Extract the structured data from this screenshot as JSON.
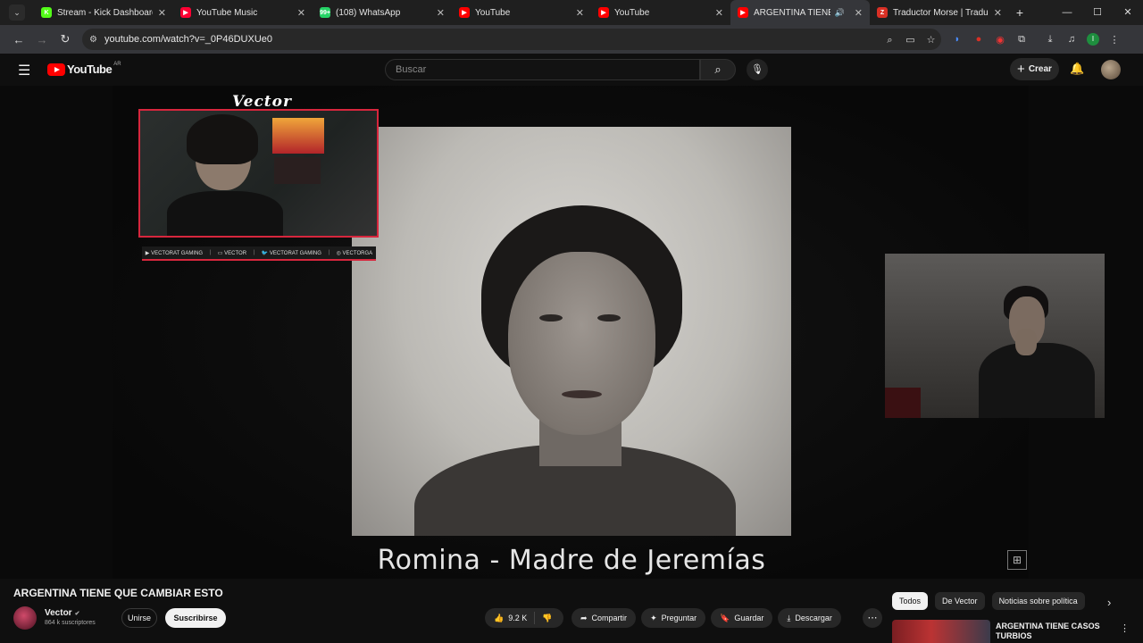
{
  "browser": {
    "tabs": [
      {
        "title": "Stream - Kick Dashboard",
        "favicon_color": "#53fc18",
        "favicon_label": "K"
      },
      {
        "title": "YouTube Music",
        "favicon_color": "#ff0033",
        "favicon_label": "▶"
      },
      {
        "title": "(108) WhatsApp",
        "favicon_color": "#25d366",
        "favicon_label": "99+"
      },
      {
        "title": "YouTube",
        "favicon_color": "#ff0000",
        "favicon_label": "▶"
      },
      {
        "title": "YouTube",
        "favicon_color": "#ff0000",
        "favicon_label": "▶"
      },
      {
        "title": "ARGENTINA TIENE QU",
        "favicon_color": "#ff0000",
        "favicon_label": "▶",
        "active": true
      },
      {
        "title": "Traductor Morse | Traduc",
        "favicon_color": "#d93025",
        "favicon_label": "Z"
      }
    ],
    "url": "youtube.com/watch?v=_0P46DUXUe0"
  },
  "youtube": {
    "region": "AR",
    "logo_text": "YouTube",
    "search_placeholder": "Buscar",
    "create_label": "Crear"
  },
  "video": {
    "overlay_brand": "Vector",
    "socials": [
      "VECTORAT GAMING",
      "VECTOR",
      "VECTORAT GAMING",
      "VECTORGA"
    ],
    "caption": "Romina - Madre de Jeremías"
  },
  "meta": {
    "title": "ARGENTINA TIENE QUE CAMBIAR ESTO",
    "channel": "Vector",
    "subscribers": "864 k suscriptores",
    "join_label": "Unirse",
    "subscribe_label": "Suscribirse",
    "likes": "9.2 K",
    "share_label": "Compartir",
    "ask_label": "Preguntar",
    "save_label": "Guardar",
    "download_label": "Descargar"
  },
  "sidebar": {
    "chips": [
      "Todos",
      "De Vector",
      "Noticias sobre política"
    ],
    "rec_title": "ARGENTINA TIENE CASOS TURBIOS"
  },
  "colors": {
    "accent": "#ff0000",
    "overlay_border": "#d7263d",
    "background": "#0f0f0f"
  }
}
